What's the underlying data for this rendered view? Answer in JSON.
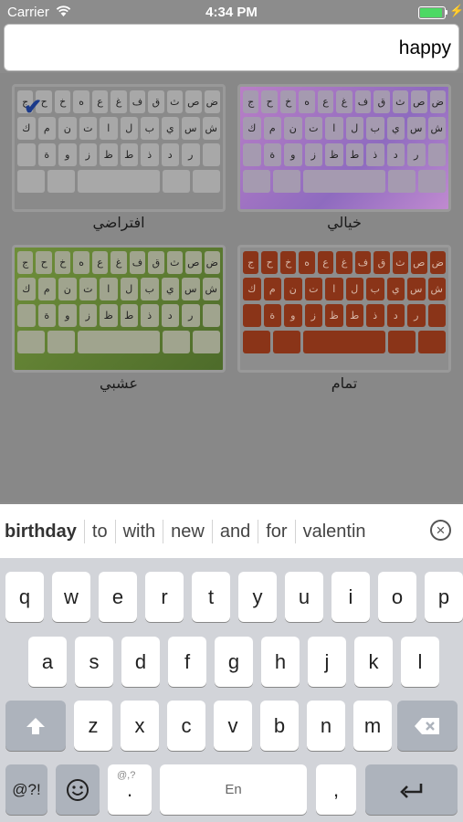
{
  "status": {
    "carrier": "Carrier",
    "time": "4:34 PM"
  },
  "field": {
    "text": "happy"
  },
  "themes": [
    {
      "name": "افتراضي",
      "selected": true
    },
    {
      "name": "خيالي",
      "selected": false
    },
    {
      "name": "عشبي",
      "selected": false
    },
    {
      "name": "تمام",
      "selected": false
    }
  ],
  "mini_rows": [
    [
      "ج",
      "ح",
      "خ",
      "ه",
      "ع",
      "غ",
      "ف",
      "ق",
      "ث",
      "ص",
      "ض"
    ],
    [
      "ك",
      "م",
      "ن",
      "ت",
      "ا",
      "ل",
      "ب",
      "ي",
      "س",
      "ش"
    ],
    [
      "",
      "ة",
      "و",
      "ز",
      "ظ",
      "ط",
      "ذ",
      "د",
      "ر",
      ""
    ],
    [
      "",
      "",
      "",
      "",
      ""
    ]
  ],
  "suggestions": [
    "birthday",
    "to",
    "with",
    "new",
    "and",
    "for",
    "valentin"
  ],
  "keyboard": {
    "row1": [
      "q",
      "w",
      "e",
      "r",
      "t",
      "y",
      "u",
      "i",
      "o",
      "p"
    ],
    "row2": [
      "a",
      "s",
      "d",
      "f",
      "g",
      "h",
      "j",
      "k",
      "l"
    ],
    "row3": [
      "z",
      "x",
      "c",
      "v",
      "b",
      "n",
      "m"
    ],
    "sym_label": "@?!",
    "period_top": "@,?",
    "period": ".",
    "space_label": "En",
    "comma": ","
  },
  "icons": [
    "wifi-icon",
    "battery-icon",
    "charging-bolt-icon",
    "checkmark-icon",
    "clear-suggestions-icon",
    "shift-icon",
    "backspace-icon",
    "emoji-icon",
    "return-icon"
  ]
}
